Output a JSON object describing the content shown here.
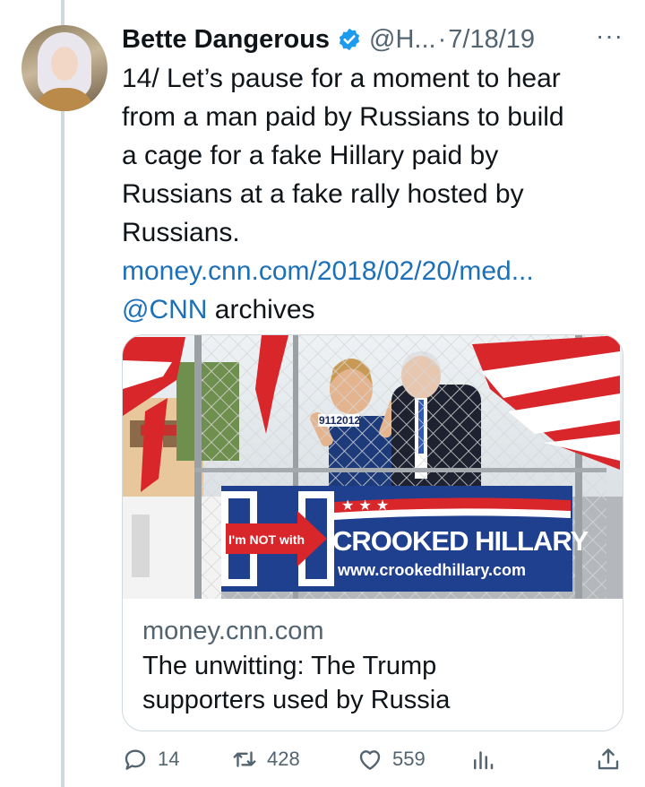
{
  "tweet": {
    "author_name": "Bette Dangerous",
    "handle": "@H...",
    "separator": "·",
    "date": "7/18/19",
    "more": "···",
    "text_lines": [
      "14/ Let’s pause for a moment to hear",
      "from a man paid by Russians to build",
      "a cage for a fake Hillary paid by",
      "Russians at a fake rally hosted by",
      "Russians."
    ],
    "link": "money.cnn.com/2018/02/20/med...",
    "mention": "@CNN",
    "mention_suffix": " archives"
  },
  "card": {
    "sign_small": "I'm NOT with",
    "sign_big": "CROOKED HILLARY",
    "sign_url": "www.crookedhillary.com",
    "cage_tag": "9112012",
    "domain": "money.cnn.com",
    "title_line1": "The unwitting: The Trump",
    "title_line2": "supporters used by Russia"
  },
  "actions": {
    "reply_count": "14",
    "retweet_count": "428",
    "like_count": "559"
  },
  "colors": {
    "link": "#1d70b8",
    "verified": "#1d9bf0",
    "muted": "#536471",
    "sign_blue": "#1f3f8f",
    "flag_red": "#d9262b"
  },
  "icons": [
    "verified-badge-icon",
    "reply-icon",
    "retweet-icon",
    "like-icon",
    "analytics-icon",
    "share-icon",
    "more-icon"
  ]
}
